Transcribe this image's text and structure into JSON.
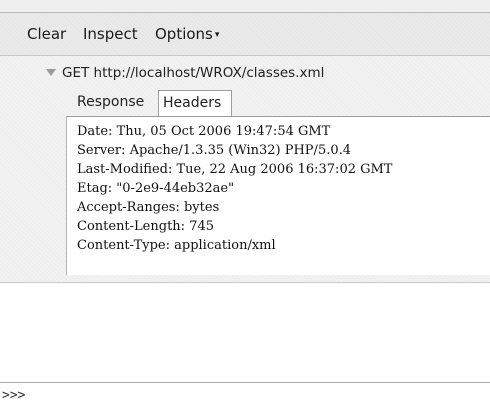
{
  "toolbar": {
    "clear_label": "Clear",
    "inspect_label": "Inspect",
    "options_label": "Options",
    "options_caret": "▾"
  },
  "request": {
    "method": "GET",
    "url": "http://localhost/WROX/classes.xml"
  },
  "tabs": [
    {
      "label": "Response",
      "selected": false
    },
    {
      "label": "Headers",
      "selected": true
    }
  ],
  "headers": [
    "Date: Thu, 05 Oct 2006 19:47:54 GMT",
    "Server: Apache/1.3.35 (Win32) PHP/5.0.4",
    "Last-Modified: Tue, 22 Aug 2006 16:37:02 GMT",
    "Etag: \"0-2e9-44eb32ae\"",
    "Accept-Ranges: bytes",
    "Content-Length: 745",
    "Content-Type: application/xml"
  ],
  "command_line": {
    "prompt": ">>>",
    "value": ""
  }
}
